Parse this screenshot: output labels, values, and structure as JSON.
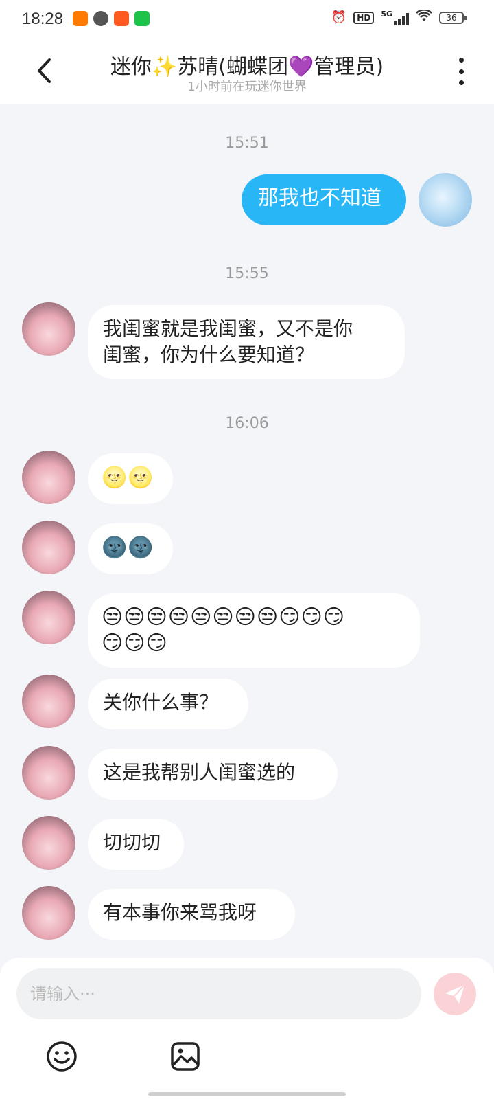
{
  "status_bar": {
    "time": "18:28",
    "network": "5G",
    "hd": "HD",
    "battery": "36"
  },
  "header": {
    "title": "迷你✨苏晴(蝴蝶团💜管理员)",
    "subtitle": "1小时前在玩迷你世界"
  },
  "messages": {
    "ts1": "15:51",
    "m1": "那我也不知道",
    "ts2": "15:55",
    "m2_line1": "我闺蜜就是我闺蜜，又不是你",
    "m2_line2": "闺蜜，你为什么要知道？",
    "ts3": "16:06",
    "m3": "🌝🌝",
    "m4": "🌚🌚",
    "m5_line1": "😒😒😒😒😒😒😒😒😏😏😏",
    "m5_line2": "😏😏😏",
    "m6": "关你什么事？",
    "m7": "这是我帮别人闺蜜选的",
    "m8": "切切切",
    "m9": "有本事你来骂我呀"
  },
  "input": {
    "placeholder": "请输入···",
    "value": ""
  },
  "icons": {
    "back": "back-arrow-icon",
    "more": "more-vertical-icon",
    "send": "send-paper-plane-icon",
    "emoji": "smiley-icon",
    "image": "image-icon"
  },
  "colors": {
    "accent_blue": "#29b6f6",
    "send_button_disabled": "#fbd3d6",
    "chat_background": "#f3f5f8"
  }
}
